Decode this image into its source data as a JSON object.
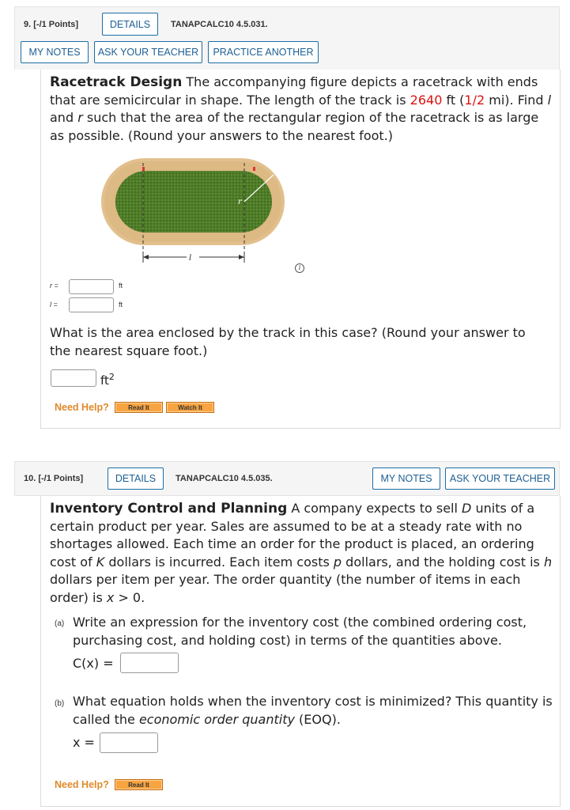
{
  "q9": {
    "number": "9.",
    "points": "[-/1 Points]",
    "details_label": "DETAILS",
    "code": "TANAPCALC10 4.5.031.",
    "my_notes_label": "MY NOTES",
    "ask_teacher_label": "ASK YOUR TEACHER",
    "practice_label": "PRACTICE ANOTHER",
    "title": "Racetrack Design",
    "text1": "The accompanying figure depicts a racetrack with ends that are semicircular in shape. The length of the track is",
    "track_length": "2640",
    "unit_ft": "ft",
    "half_mile": "1/2",
    "unit_mi": "mi",
    "text2": "Find",
    "var_l": "l",
    "and": "and",
    "var_r": "r",
    "text3": "such that the area of the rectangular region of the racetrack is as large as possible. (Round your answers to the nearest foot.)",
    "figure": {
      "label_l": "l",
      "label_r": "r"
    },
    "info_icon": "info-icon",
    "r_label": "r =",
    "r_unit": "ft",
    "l_label": "l =",
    "l_unit": "ft",
    "area_question": "What is the area enclosed by the track in this case? (Round your answer to the nearest square foot.)",
    "area_unit": "ft",
    "area_exp": "2",
    "need_help": "Need Help?",
    "read_it": "Read It",
    "watch_it": "Watch It"
  },
  "q10": {
    "number": "10.",
    "points": "[-/1 Points]",
    "details_label": "DETAILS",
    "code": "TANAPCALC10 4.5.035.",
    "my_notes_label": "MY NOTES",
    "ask_teacher_label": "ASK YOUR TEACHER",
    "title": "Inventory Control and Planning",
    "text_a": "A company expects to sell",
    "var_D": "D",
    "text_b": "units of a certain product per year. Sales are assumed to be at a steady rate with no shortages allowed. Each time an order for the product is placed, an ordering cost of",
    "var_K": "K",
    "text_c": "dollars is incurred. Each item costs",
    "var_p": "p",
    "text_d": "dollars, and the holding cost is",
    "var_h": "h",
    "text_e": "dollars per item per year. The order quantity (the number of items in each order) is",
    "var_x": "x",
    "text_f": "> 0.",
    "part_a_label": "(a)",
    "part_a_text": "Write an expression for the inventory cost (the combined ordering cost, purchasing cost, and holding cost) in terms of the quantities above.",
    "cx_label": "C(x) =",
    "part_b_label": "(b)",
    "part_b_text1": "What equation holds when the inventory cost is minimized? This quantity is called the",
    "part_b_eoq": "economic order quantity",
    "part_b_text2": "(EOQ).",
    "x_label": "x =",
    "need_help": "Need Help?",
    "read_it": "Read It"
  },
  "colors": {
    "accent": "#1c6ea4",
    "help_orange": "#e08a2a",
    "highlight_red": "#d11111"
  }
}
